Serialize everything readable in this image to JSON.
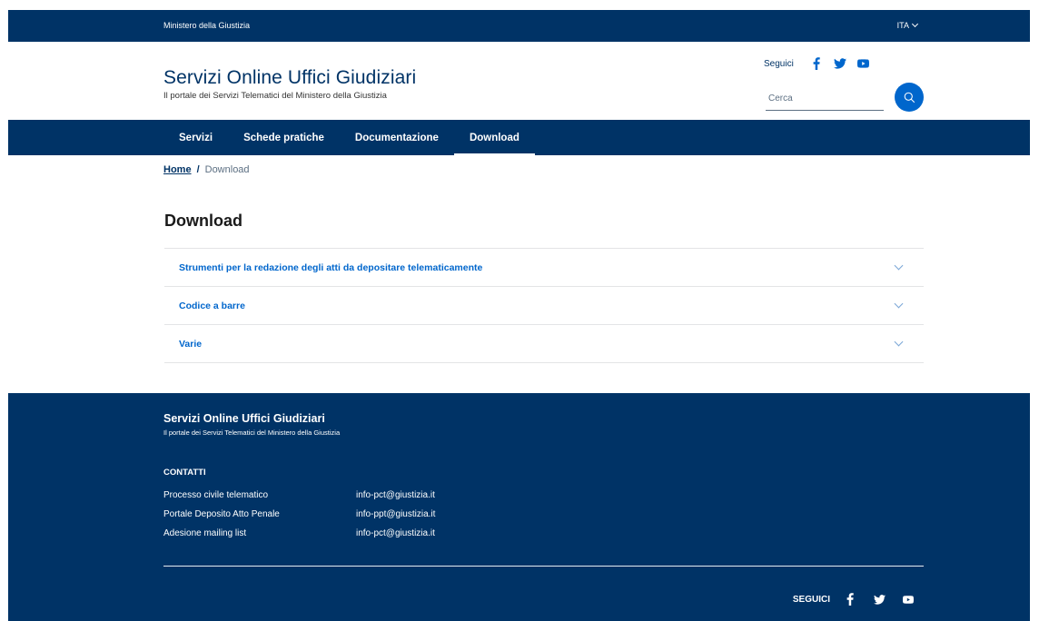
{
  "topbar": {
    "owner": "Ministero della Giustizia",
    "language": "ITA"
  },
  "header": {
    "title": "Servizi Online Uffici Giudiziari",
    "subtitle": "Il portale dei Servizi Telematici del Ministero della Giustizia",
    "follow_label": "Seguici",
    "social": [
      "facebook-icon",
      "twitter-icon",
      "youtube-icon"
    ],
    "search_placeholder": "Cerca"
  },
  "nav": {
    "items": [
      {
        "label": "Servizi"
      },
      {
        "label": "Schede pratiche"
      },
      {
        "label": "Documentazione"
      },
      {
        "label": "Download",
        "active": true
      }
    ]
  },
  "breadcrumb": {
    "home": "Home",
    "separator": "/",
    "current": "Download"
  },
  "page": {
    "title": "Download"
  },
  "accordion": {
    "items": [
      {
        "label": "Strumenti per la redazione degli atti da depositare telematicamente"
      },
      {
        "label": "Codice a barre"
      },
      {
        "label": "Varie"
      }
    ]
  },
  "footer": {
    "title": "Servizi Online Uffici Giudiziari",
    "subtitle": "Il portale dei Servizi Telematici del Ministero della Giustizia",
    "contacts_heading": "CONTATTI",
    "contacts": [
      {
        "name": "Processo civile telematico",
        "email": "info-pct@giustizia.it"
      },
      {
        "name": "Portale Deposito Atto Penale",
        "email": "info-ppt@giustizia.it"
      },
      {
        "name": "Adesione mailing list",
        "email": "info-pct@giustizia.it"
      }
    ],
    "follow_label": "SEGUICI"
  },
  "colors": {
    "primary": "#003366",
    "accent": "#0066cc",
    "divider": "#e3e4e6"
  }
}
